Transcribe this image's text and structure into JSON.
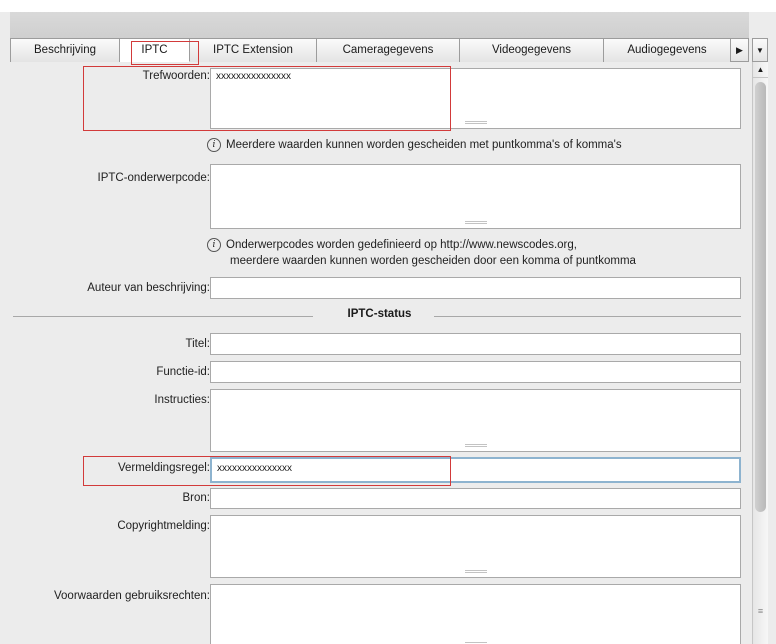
{
  "tabs": [
    {
      "label": "Beschrijving"
    },
    {
      "label": "IPTC"
    },
    {
      "label": "IPTC Extension"
    },
    {
      "label": "Cameragegevens"
    },
    {
      "label": "Videogegevens"
    },
    {
      "label": "Audiogegevens"
    }
  ],
  "tab_more_icon": "triangle-right-icon",
  "tab_menu_icon": "triangle-down-icon",
  "fields": {
    "trefwoorden": {
      "label": "Trefwoorden:",
      "value": "xxxxxxxxxxxxxxx"
    },
    "trefwoorden_hint": "Meerdere waarden kunnen worden gescheiden met puntkomma's of komma's",
    "onderwerpcode": {
      "label": "IPTC-onderwerpcode:",
      "value": ""
    },
    "onderwerpcode_hint_1": "Onderwerpcodes worden gedefinieerd op http://www.newscodes.org,",
    "onderwerpcode_hint_2": "meerdere waarden kunnen worden gescheiden door een komma of puntkomma",
    "auteur": {
      "label": "Auteur van beschrijving:",
      "value": ""
    },
    "section_title": "IPTC-status",
    "titel": {
      "label": "Titel:",
      "value": ""
    },
    "functie": {
      "label": "Functie-id:",
      "value": ""
    },
    "instructies": {
      "label": "Instructies:",
      "value": ""
    },
    "vermelding": {
      "label": "Vermeldingsregel:",
      "value": "xxxxxxxxxxxxxxx"
    },
    "bron": {
      "label": "Bron:",
      "value": ""
    },
    "copyright": {
      "label": "Copyrightmelding:",
      "value": ""
    },
    "voorwaarden": {
      "label": "Voorwaarden gebruiksrechten:",
      "value": ""
    }
  },
  "colors": {
    "highlight": "#d23a3a",
    "focus": "#8db3cf"
  }
}
